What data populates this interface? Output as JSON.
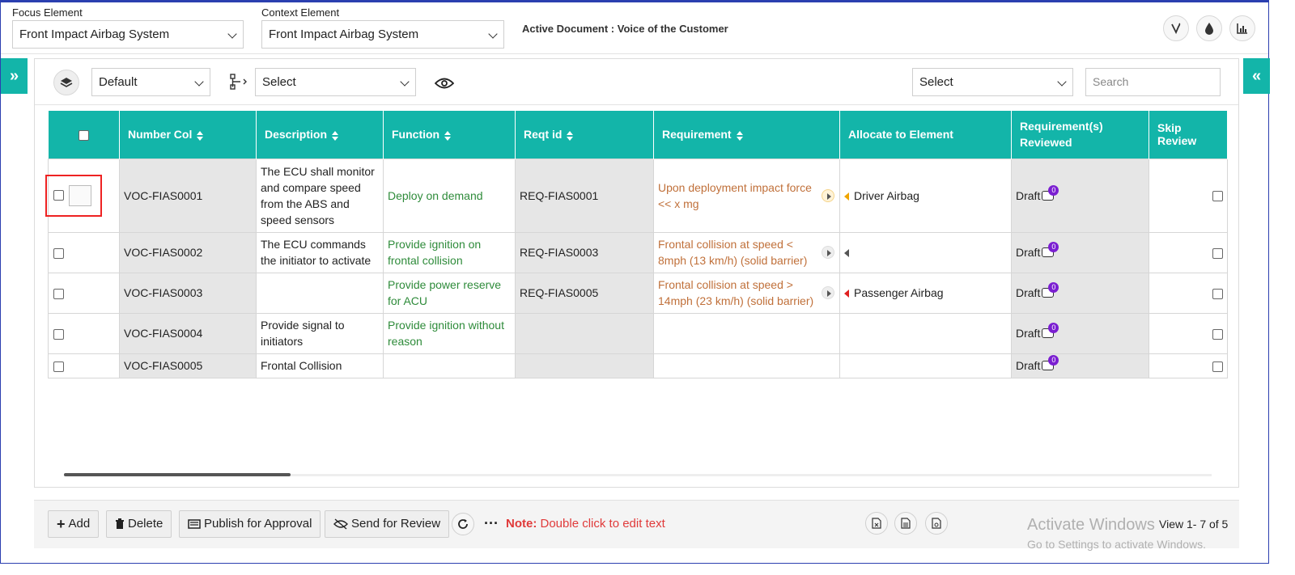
{
  "header": {
    "focus_label": "Focus Element",
    "focus_value": "Front Impact Airbag System",
    "context_label": "Context Element",
    "context_value": "Front Impact Airbag System",
    "active_document": "Active Document : Voice of the Customer",
    "icons": [
      "vine-icon",
      "drop-icon",
      "bar-chart-icon"
    ]
  },
  "toolbar": {
    "view_select": "Default",
    "hierarchy_select": "Select",
    "right_select": "Select",
    "search_placeholder": "Search"
  },
  "table": {
    "columns": [
      "Number Col",
      "Description",
      "Function",
      "Reqt id",
      "Requirement",
      "Allocate to Element",
      "Requirement(s) Reviewed",
      "Skip Review"
    ],
    "rows": [
      {
        "number": "VOC-FIAS0001",
        "description": "The ECU shall monitor and compare speed from the ABS and speed sensors",
        "function": "Deploy on demand",
        "reqt_id": "REQ-FIAS0001",
        "requirement": "Upon deployment impact force << x mg",
        "element": "Driver Airbag",
        "reviewed": "Draft",
        "comments": "0"
      },
      {
        "number": "VOC-FIAS0002",
        "description": "The ECU commands the initiator to activate",
        "function": "Provide ignition on frontal collision",
        "reqt_id": "REQ-FIAS0003",
        "requirement": "Frontal collision at speed < 8mph (13 km/h) (solid barrier)",
        "element": "",
        "reviewed": "Draft",
        "comments": "0"
      },
      {
        "number": "VOC-FIAS0003",
        "description": "",
        "function": "Provide power reserve for ACU",
        "reqt_id": "REQ-FIAS0005",
        "requirement": "Frontal collision at speed > 14mph (23 km/h) (solid barrier)",
        "element": "Passenger Airbag",
        "reviewed": "Draft",
        "comments": "0"
      },
      {
        "number": "VOC-FIAS0004",
        "description": "Provide signal to initiators",
        "function": "Provide ignition without reason",
        "reqt_id": "",
        "requirement": "",
        "element": "",
        "reviewed": "Draft",
        "comments": "0"
      },
      {
        "number": "VOC-FIAS0005",
        "description": "Frontal Collision",
        "function": "",
        "reqt_id": "",
        "requirement": "",
        "element": "",
        "reviewed": "Draft",
        "comments": "0"
      }
    ]
  },
  "footer": {
    "add": "Add",
    "delete": "Delete",
    "publish": "Publish for Approval",
    "send_review": "Send for Review",
    "note_label": "Note:",
    "note_text": "Double click to edit text",
    "watermark_title": "Activate Windows",
    "watermark_sub": "Go to Settings to activate Windows.",
    "pager": "View 1- 7 of 5"
  }
}
